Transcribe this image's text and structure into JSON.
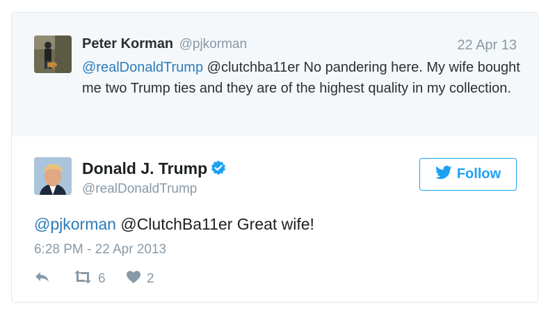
{
  "reply_context": {
    "name": "Peter Korman",
    "handle": "@pjkorman",
    "date": "22 Apr 13",
    "mention": "@realDonaldTrump",
    "text": " @clutchba11er No pandering here. My wife bought me two Trump ties and they are of the highest quality in my collection."
  },
  "tweet": {
    "name": "Donald J. Trump",
    "handle": "@realDonaldTrump",
    "follow_label": "Follow",
    "mention": "@pjkorman",
    "text": " @ClutchBa11er Great wife!",
    "timestamp": "6:28 PM - 22 Apr 2013",
    "retweet_count": "6",
    "like_count": "2"
  },
  "colors": {
    "link": "#2b7bb9",
    "brand": "#1da1f2",
    "muted": "#8899a6",
    "reply_bg": "#f5f8fa"
  },
  "icons": [
    "reply-icon",
    "retweet-icon",
    "heart-icon",
    "verified-badge-icon",
    "twitter-bird-icon"
  ]
}
